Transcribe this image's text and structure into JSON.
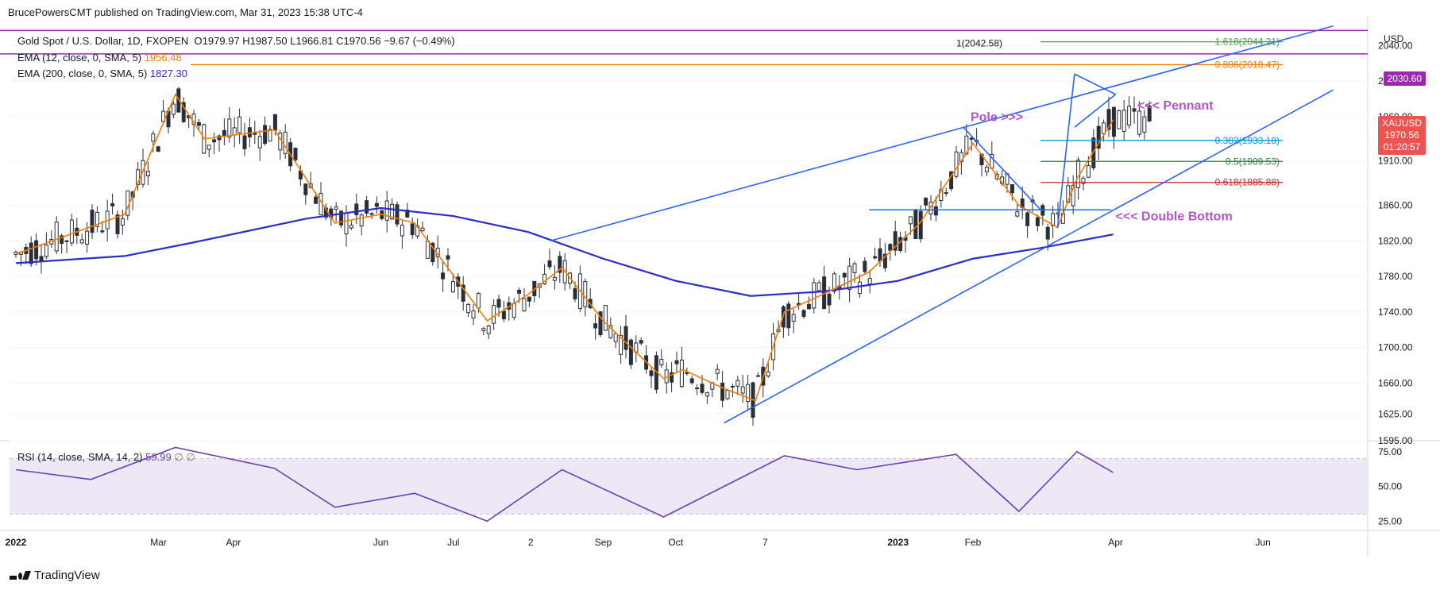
{
  "header": {
    "publisher": "BrucePowersCMT published on TradingView.com, Mar 31, 2023 15:38 UTC-4"
  },
  "legend": {
    "symbol": "Gold Spot / U.S. Dollar, 1D, FXOPEN",
    "ohlc": "O1979.97  H1987.50  L1966.81  C1970.56  −9.67 (−0.49%)",
    "ema12_label": "EMA (12, close, 0, SMA, 5)",
    "ema12_value": "1956.48",
    "ema200_label": "EMA (200, close, 0, SMA, 5)",
    "ema200_value": "1827.30",
    "rsi_label": "RSI (14, close, SMA, 14, 2)",
    "rsi_value": "59.99",
    "rsi_extra": "∅  ∅"
  },
  "price_axis": {
    "unit": "USD",
    "ticks": [
      "2040.00",
      "2000.00",
      "1960.00",
      "1910.00",
      "1860.00",
      "1820.00",
      "1780.00",
      "1740.00",
      "1700.00",
      "1660.00",
      "1625.00",
      "1595.00"
    ],
    "hline_label": "2030.60",
    "last_label": "XAUUSD",
    "last_price": "1970.56",
    "countdown": "01:20:57"
  },
  "rsi_axis": {
    "ticks": [
      "75.00",
      "50.00",
      "25.00"
    ]
  },
  "time_axis": {
    "labels": [
      "2022",
      "Mar",
      "Apr",
      "Jun",
      "Jul",
      "2",
      "Sep",
      "Oct",
      "7",
      "2023",
      "Feb",
      "Apr",
      "Jun"
    ]
  },
  "fib": [
    {
      "label": "1(2042.58)",
      "color": "#131722"
    },
    {
      "label": "1.618(2044.21)",
      "color": "#43a047"
    },
    {
      "label": "0.886(2018.47)",
      "color": "#f57c00"
    },
    {
      "label": "0.382(1933.18)",
      "color": "#039be5"
    },
    {
      "label": "0.5(1909.53)",
      "color": "#2e7d32"
    },
    {
      "label": "0.618(1885.88)",
      "color": "#c62828"
    }
  ],
  "annotations": {
    "pole": "Pole >>>",
    "pennant": "<<< Pennant",
    "double_bottom": "<<< Double Bottom"
  },
  "brand": "TradingView",
  "colors": {
    "up": "#26a69a",
    "down": "#ef5350",
    "candle": "#2a2e39",
    "ema12": "#f57c00",
    "ema200": "#2a2ccc",
    "trend": "#2962ff",
    "rsi": "#6a3fb5",
    "rsi_band": "#ede7f6",
    "annot": "#b455c9",
    "hline": "#9c27b0"
  },
  "chart_data": {
    "type": "line",
    "title": "Gold Spot / U.S. Dollar, 1D, FXOPEN",
    "series": [
      {
        "name": "EMA (12, close, 0, SMA, 5)",
        "x": [
          "2022-01-01",
          "2022-02-15",
          "2022-03-08",
          "2022-03-20",
          "2022-04-18",
          "2022-05-13",
          "2022-06-01",
          "2022-06-15",
          "2022-07-15",
          "2022-08-01",
          "2022-08-15",
          "2022-09-01",
          "2022-09-26",
          "2022-10-04",
          "2022-10-20",
          "2022-11-03",
          "2022-11-15",
          "2022-12-01",
          "2022-12-20",
          "2023-01-10",
          "2023-02-01",
          "2023-02-20",
          "2023-03-08",
          "2023-03-16",
          "2023-03-31"
        ],
        "values": [
          1805,
          1850,
          1985,
          1935,
          1945,
          1840,
          1850,
          1840,
          1730,
          1760,
          1790,
          1730,
          1665,
          1675,
          1655,
          1640,
          1740,
          1760,
          1785,
          1840,
          1930,
          1860,
          1835,
          1890,
          1956.48
        ]
      },
      {
        "name": "EMA (200, close, 0, SMA, 5)",
        "x": [
          "2022-01-01",
          "2022-02-15",
          "2022-03-15",
          "2022-05-01",
          "2022-06-01",
          "2022-07-01",
          "2022-08-01",
          "2022-09-01",
          "2022-10-01",
          "2022-11-01",
          "2022-12-01",
          "2023-01-01",
          "2023-02-01",
          "2023-03-01",
          "2023-03-31"
        ],
        "values": [
          1795,
          1803,
          1818,
          1845,
          1857,
          1848,
          1830,
          1800,
          1775,
          1758,
          1763,
          1775,
          1800,
          1812,
          1827.3
        ]
      },
      {
        "name": "RSI (14, close, SMA, 14, 2)",
        "x": [
          "2022-01-01",
          "2022-02-01",
          "2022-03-08",
          "2022-04-18",
          "2022-05-13",
          "2022-06-15",
          "2022-07-15",
          "2022-08-15",
          "2022-09-26",
          "2022-11-15",
          "2022-12-15",
          "2023-01-25",
          "2023-02-20",
          "2023-03-16",
          "2023-03-31"
        ],
        "values": [
          62,
          55,
          78,
          63,
          35,
          45,
          25,
          62,
          28,
          72,
          62,
          73,
          32,
          75,
          59.99
        ]
      }
    ],
    "ylim": [
      1595,
      2060
    ],
    "rsi_ylim": [
      20,
      80
    ],
    "fib_levels": [
      2044.21,
      2018.47,
      1933.18,
      1909.53,
      1885.88
    ],
    "grid": true,
    "legend": "top-left"
  }
}
